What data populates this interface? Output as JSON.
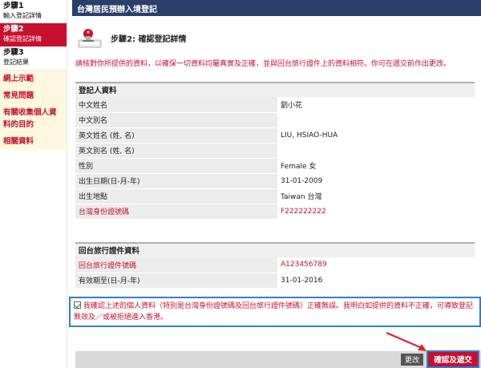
{
  "sidebar": {
    "steps": [
      {
        "title": "步驟1",
        "sub": "輸入登記詳情"
      },
      {
        "title": "步驟2",
        "sub": "確認登記詳情"
      },
      {
        "title": "步驟3",
        "sub": "登記結果"
      }
    ],
    "links": [
      "網上示範",
      "常見問題",
      "有關收集個人資料的目的",
      "相關資料"
    ]
  },
  "header": {
    "title": "台灣居民預辦入境登記"
  },
  "step_heading": "步驟2: 確認登記詳情",
  "instruction": "請核對你所提供的資料，以確保一切資料均屬真實及正確，並與回台旅行證件上的資料相符。你可在遞交前作出更改。",
  "registrant": {
    "heading": "登記人資料",
    "rows": [
      {
        "label": "中文姓名",
        "value": "劉小花"
      },
      {
        "label": "中文別名",
        "value": ""
      },
      {
        "label": "英文姓名 (姓, 名)",
        "value": "LIU, HSIAO-HUA"
      },
      {
        "label": "英文別名 (姓, 名)",
        "value": ""
      },
      {
        "label": "性別",
        "value": "Female 女"
      },
      {
        "label": "出生日期(日-月-年)",
        "value": "31-01-2009"
      },
      {
        "label": "出生地點",
        "value": "Taiwan 台灣"
      },
      {
        "label": "台灣身份證號碼",
        "value": "F222222222"
      }
    ]
  },
  "travel_doc": {
    "heading": "回台旅行證件資料",
    "rows": [
      {
        "label": "回台旅行證件號碼",
        "value": "A123456789"
      },
      {
        "label": "有效期至(日-月-年)",
        "value": "31-01-2016"
      }
    ]
  },
  "confirm_text": "我確認上述的個人資料（特別是台灣身份證號碼及回台旅行證件號碼）正確無誤。我明白如提供的資料不正確，可導致登記無效及／或被拒絕進入香港。",
  "confirm_checked": true,
  "buttons": {
    "edit": "更改",
    "submit": "確認及遞交"
  },
  "colors": {
    "brand": "#2b3f6b",
    "accent": "#c8102e",
    "highlight": "#2f7fd1"
  }
}
